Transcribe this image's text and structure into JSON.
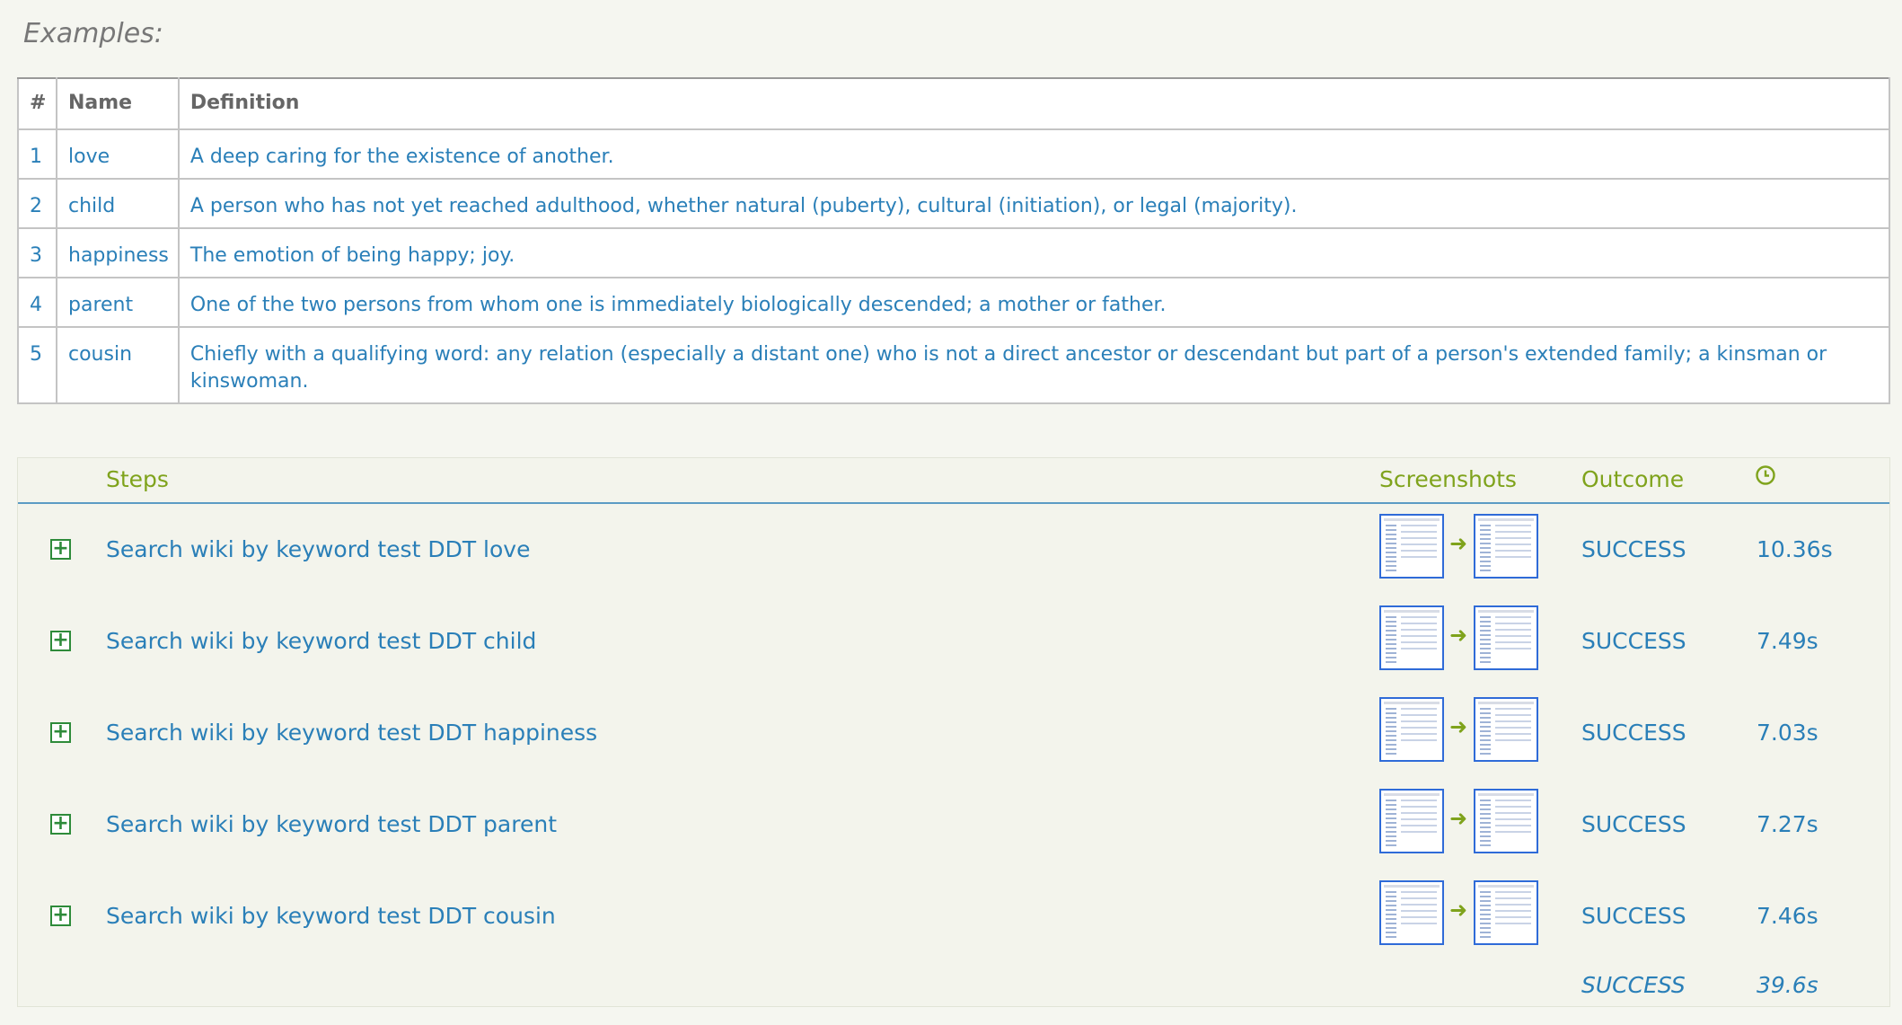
{
  "examples": {
    "heading": "Examples:",
    "columns": [
      "#",
      "Name",
      "Definition"
    ],
    "rows": [
      {
        "num": "1",
        "name": "love",
        "definition": "A deep caring for the existence of another."
      },
      {
        "num": "2",
        "name": "child",
        "definition": "A person who has not yet reached adulthood, whether natural (puberty), cultural (initiation), or legal (majority)."
      },
      {
        "num": "3",
        "name": "happiness",
        "definition": "The emotion of being happy; joy."
      },
      {
        "num": "4",
        "name": "parent",
        "definition": "One of the two persons from whom one is immediately biologically descended; a mother or father."
      },
      {
        "num": "5",
        "name": "cousin",
        "definition": "Chiefly with a qualifying word: any relation (especially a distant one) who is not a direct ancestor or descendant but part of a person's extended family; a kinsman or kinswoman."
      }
    ]
  },
  "steps": {
    "headers": {
      "steps": "Steps",
      "screenshots": "Screenshots",
      "outcome": "Outcome",
      "duration_icon": "clock-icon"
    },
    "rows": [
      {
        "label": "Search wiki by keyword test DDT love",
        "outcome": "SUCCESS",
        "duration": "10.36s"
      },
      {
        "label": "Search wiki by keyword test DDT child",
        "outcome": "SUCCESS",
        "duration": "7.49s"
      },
      {
        "label": "Search wiki by keyword test DDT happiness",
        "outcome": "SUCCESS",
        "duration": "7.03s"
      },
      {
        "label": "Search wiki by keyword test DDT parent",
        "outcome": "SUCCESS",
        "duration": "7.27s"
      },
      {
        "label": "Search wiki by keyword test DDT cousin",
        "outcome": "SUCCESS",
        "duration": "7.46s"
      }
    ],
    "summary": {
      "outcome": "SUCCESS",
      "duration": "39.6s"
    }
  },
  "colors": {
    "accent_green": "#7fa31c",
    "link_blue": "#2a7fb8",
    "thumb_border": "#2f6bd8",
    "expand_green": "#2e8b3a"
  }
}
